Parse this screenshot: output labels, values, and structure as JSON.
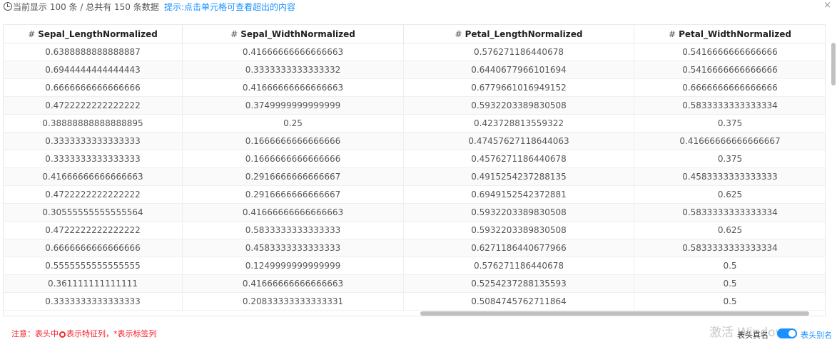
{
  "topbar": {
    "count_text": "当前显示 100 条 / 总共有 150 条数据",
    "hint_text": "提示:点击单元格可查看超出的内容",
    "close_glyph": "×"
  },
  "table": {
    "columns": [
      {
        "icon": "#",
        "label": "Sepal_LengthNormalized"
      },
      {
        "icon": "#",
        "label": "Sepal_WidthNormalized"
      },
      {
        "icon": "#",
        "label": "Petal_LengthNormalized"
      },
      {
        "icon": "#",
        "label": "Petal_WidthNormalized"
      }
    ],
    "rows": [
      [
        "0.6388888888888887",
        "0.41666666666666663",
        "0.576271186440678",
        "0.5416666666666666"
      ],
      [
        "0.6944444444444443",
        "0.3333333333333332",
        "0.6440677966101694",
        "0.5416666666666666"
      ],
      [
        "0.6666666666666666",
        "0.41666666666666663",
        "0.6779661016949152",
        "0.6666666666666666"
      ],
      [
        "0.4722222222222222",
        "0.3749999999999999",
        "0.5932203389830508",
        "0.5833333333333334"
      ],
      [
        "0.38888888888888895",
        "0.25",
        "0.423728813559322",
        "0.375"
      ],
      [
        "0.3333333333333333",
        "0.1666666666666666",
        "0.47457627118644063",
        "0.41666666666666667"
      ],
      [
        "0.3333333333333333",
        "0.1666666666666666",
        "0.4576271186440678",
        "0.375"
      ],
      [
        "0.41666666666666663",
        "0.2916666666666667",
        "0.4915254237288135",
        "0.4583333333333333"
      ],
      [
        "0.4722222222222222",
        "0.2916666666666667",
        "0.6949152542372881",
        "0.625"
      ],
      [
        "0.30555555555555564",
        "0.41666666666666663",
        "0.5932203389830508",
        "0.5833333333333334"
      ],
      [
        "0.4722222222222222",
        "0.5833333333333333",
        "0.5932203389830508",
        "0.625"
      ],
      [
        "0.6666666666666666",
        "0.4583333333333333",
        "0.6271186440677966",
        "0.5833333333333334"
      ],
      [
        "0.5555555555555555",
        "0.1249999999999999",
        "0.576271186440678",
        "0.5"
      ],
      [
        "0.361111111111111",
        "0.41666666666666663",
        "0.5254237288135593",
        "0.5"
      ],
      [
        "0.3333333333333333",
        "0.20833333333333331",
        "0.5084745762711864",
        "0.5"
      ]
    ]
  },
  "footer": {
    "note_prefix": "注意：表头中",
    "note_suffix": "表示特征列，*表示标签列",
    "toggle_left_label": "表头真名",
    "toggle_right_label": "表头别名",
    "toggle_on": true,
    "watermark": "激活 Windows"
  },
  "colors": {
    "accent": "#1890ff",
    "warning": "#f5222d"
  }
}
